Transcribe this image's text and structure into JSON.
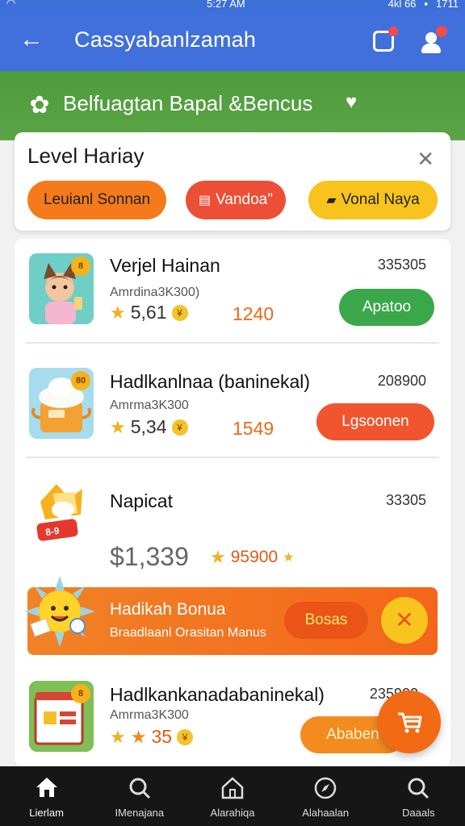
{
  "status_bar": {
    "time": "5:27 AM",
    "right_text": "4kl 66",
    "battery": "1711"
  },
  "app_bar": {
    "title": "Cassyabanlzamah"
  },
  "promo_strip": {
    "text": "Belfuagtan Bapal &Bencus"
  },
  "level_card": {
    "heading": "Level Hariay",
    "chips": [
      {
        "label": "Leuianl Sonnan",
        "color": "#f47a1b"
      },
      {
        "label": "Vandoa\"",
        "color": "#ec4f36"
      },
      {
        "label": "Vonal Naya",
        "color": "#f8c31c"
      }
    ]
  },
  "items": [
    {
      "name": "Verjel Hainan",
      "sub": "Amrdina3K300)",
      "rating": "5,61",
      "points": "1240",
      "code": "335305",
      "action": "Apatoo",
      "action_color": "#3aa84a",
      "badge": "8"
    },
    {
      "name": "Hadlkanlnaa (baninekal)",
      "sub": "Amrma3K300",
      "rating": "5,34",
      "points": "1549",
      "code": "208900",
      "action": "Lgsoonen",
      "action_color": "#f0552e",
      "badge": "80"
    },
    {
      "name": "Napicat",
      "price": "$1,339",
      "rating": "95900",
      "code": "33305"
    },
    {
      "name": "Hadlkankanadabaninekal)",
      "sub": "Amrma3K300",
      "rating": "35",
      "code": "235900",
      "action": "Ababen",
      "action_color": "#f48b1f",
      "badge": "8"
    }
  ],
  "bonus_banner": {
    "title": "Hadikah Bonua",
    "desc": "Braadlaanl Orasitan Manus",
    "button": "Bosas"
  },
  "bottom_nav": [
    {
      "label": "Lierlam",
      "icon": "home-icon",
      "active": true
    },
    {
      "label": "IMenajana",
      "icon": "search-icon"
    },
    {
      "label": "Alarahiqa",
      "icon": "house-icon"
    },
    {
      "label": "Alahaalan",
      "icon": "compass-icon"
    },
    {
      "label": "Daaals",
      "icon": "search-icon"
    }
  ]
}
